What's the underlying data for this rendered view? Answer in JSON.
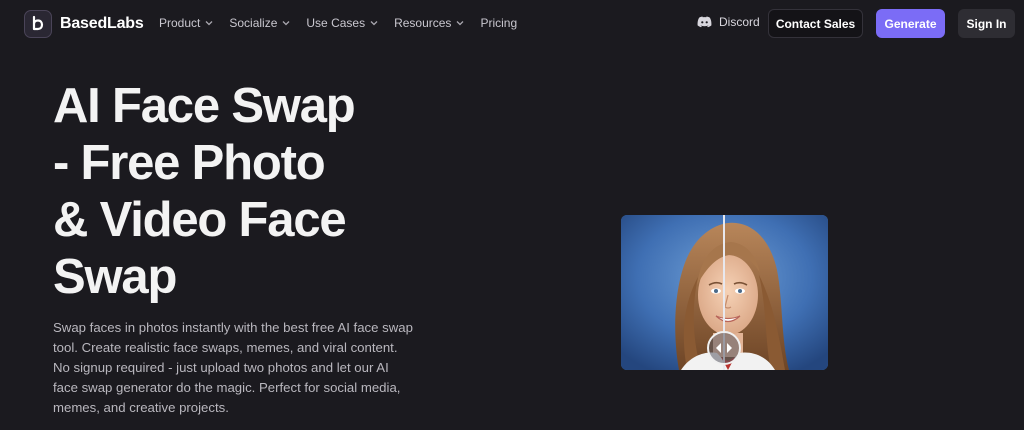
{
  "brand": {
    "name": "BasedLabs",
    "logo_icon": "b-logo-icon"
  },
  "nav": [
    {
      "label": "Product",
      "dropdown": true
    },
    {
      "label": "Socialize",
      "dropdown": true
    },
    {
      "label": "Use Cases",
      "dropdown": true
    },
    {
      "label": "Resources",
      "dropdown": true
    },
    {
      "label": "Pricing",
      "dropdown": false
    }
  ],
  "header_actions": {
    "discord_label": "Discord",
    "contact_label": "Contact Sales",
    "generate_label": "Generate",
    "signin_label": "Sign In"
  },
  "hero": {
    "title_lines": [
      "AI Face Swap",
      "- Free Photo",
      "& Video Face",
      "Swap"
    ],
    "description": "Swap faces in photos instantly with the best free AI face swap tool. Create realistic face swaps, memes, and viral content. No signup required - just upload two photos and let our AI face swap generator do the magic. Perfect for social media, memes, and creative projects."
  },
  "colors": {
    "background": "#1b1a1f",
    "accent": "#7b6cf6",
    "text_primary": "#f3f3f3",
    "text_secondary": "#b9b7be"
  }
}
